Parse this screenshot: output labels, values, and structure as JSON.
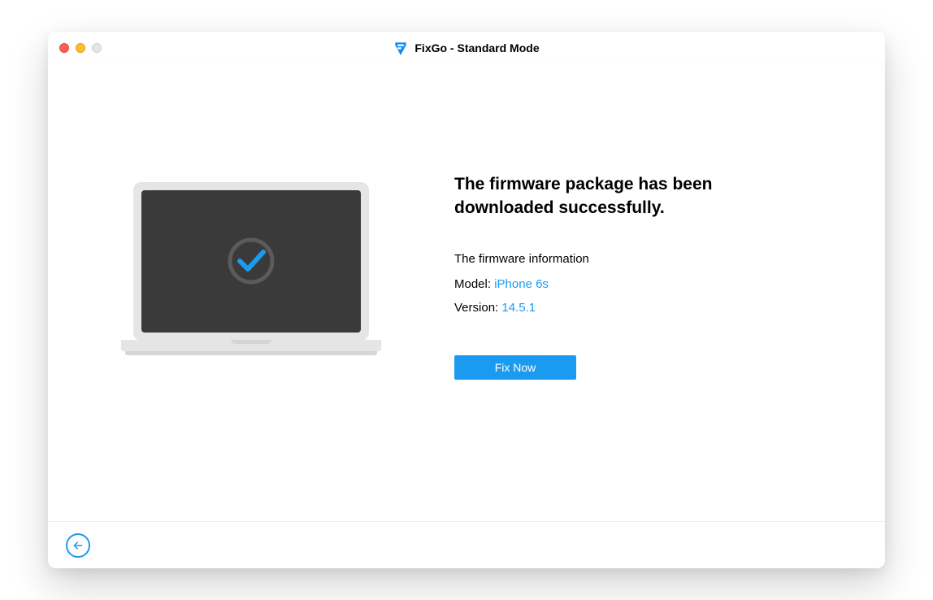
{
  "window": {
    "title": "FixGo - Standard Mode"
  },
  "main": {
    "heading": "The firmware package has been downloaded successfully.",
    "info_heading": "The firmware information",
    "model_label": "Model:",
    "model_value": "iPhone 6s",
    "version_label": "Version:",
    "version_value": "14.5.1",
    "fix_button_label": "Fix Now"
  },
  "colors": {
    "accent": "#1b9bf0"
  }
}
